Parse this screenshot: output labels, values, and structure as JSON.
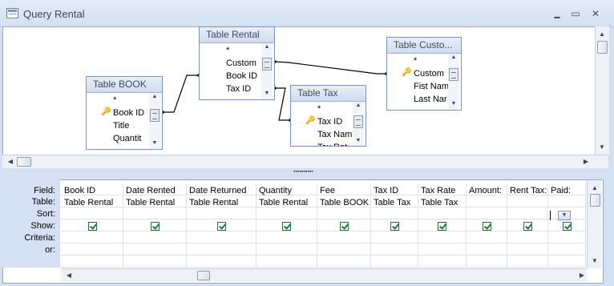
{
  "window": {
    "title": "Query Rental",
    "controls": {
      "minimize": "▬",
      "maximize": "▭",
      "close": "✕"
    }
  },
  "tables": [
    {
      "title": "Table BOOK",
      "rows": [
        "*",
        "Book ID",
        "Title",
        "Quantit"
      ],
      "key_row": 1
    },
    {
      "title": "Table Rental",
      "rows": [
        "*",
        "Custom",
        "Book ID",
        "Tax ID"
      ],
      "key_row": -1
    },
    {
      "title": "Table Tax",
      "rows": [
        "*",
        "Tax ID",
        "Tax Nam",
        "Tax Rat"
      ],
      "key_row": 1
    },
    {
      "title": "Table Custo...",
      "rows": [
        "*",
        "Custom",
        "Fist Nam",
        "Last Nar"
      ],
      "key_row": 1
    }
  ],
  "grid": {
    "row_labels": [
      "Field:",
      "Table:",
      "Sort:",
      "Show:",
      "Criteria:",
      "or:"
    ],
    "columns": [
      {
        "field": "Book ID",
        "table": "Table Rental",
        "show": true
      },
      {
        "field": "Date Rented",
        "table": "Table Rental",
        "show": true
      },
      {
        "field": "Date Returned",
        "table": "Table Rental",
        "show": true
      },
      {
        "field": "Quantity",
        "table": "Table Rental",
        "show": true
      },
      {
        "field": "Fee",
        "table": "Table BOOK",
        "show": true
      },
      {
        "field": "Tax ID",
        "table": "Table Tax",
        "show": true
      },
      {
        "field": "Tax Rate",
        "table": "Table Tax",
        "show": true
      },
      {
        "field": "Amount:",
        "table": "",
        "show": true
      },
      {
        "field": "Rent Tax:",
        "table": "",
        "show": true
      },
      {
        "field": "Paid:",
        "table": "",
        "show": true
      }
    ]
  },
  "icons": {
    "key": "key-icon",
    "checkbox": "checkmark-icon",
    "grip": "splitter-grip-icon"
  }
}
